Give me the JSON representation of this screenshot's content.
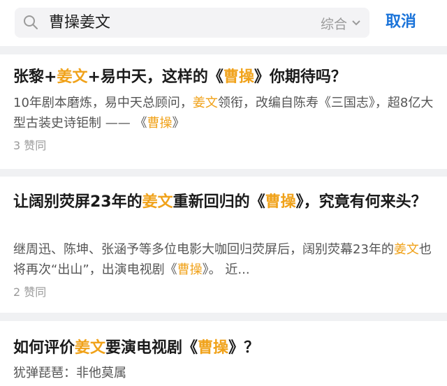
{
  "search": {
    "query": "曹操姜文",
    "filter_label": "综合",
    "cancel_label": "取消"
  },
  "results": [
    {
      "title": [
        {
          "t": "张黎+"
        },
        {
          "t": "姜文",
          "hl": true
        },
        {
          "t": "+易中天，这样的《"
        },
        {
          "t": "曹操",
          "hl": true
        },
        {
          "t": "》你期待吗？"
        }
      ],
      "excerpt": [
        {
          "t": "10年剧本磨炼，易中天总顾问，"
        },
        {
          "t": "姜文",
          "hl": true
        },
        {
          "t": "领衔，改编自陈寿《三国志》，超8亿大型古装史诗钜制 —— 《"
        },
        {
          "t": "曹操",
          "hl": true
        },
        {
          "t": "》"
        }
      ],
      "votes": "3 赞同"
    },
    {
      "title": [
        {
          "t": "让阔别荧屏23年的"
        },
        {
          "t": "姜文",
          "hl": true
        },
        {
          "t": "重新回归的《"
        },
        {
          "t": "曹操",
          "hl": true
        },
        {
          "t": "》，究竟有何来头？"
        }
      ],
      "excerpt": [
        {
          "t": "继周迅、陈坤、张涵予等多位电影大咖回归荧屏后，阔别荧幕23年的"
        },
        {
          "t": "姜文",
          "hl": true
        },
        {
          "t": "也将再次“出山”，出演电视剧《"
        },
        {
          "t": "曹操",
          "hl": true
        },
        {
          "t": "》。 近..."
        }
      ],
      "votes": "2 赞同"
    },
    {
      "title": [
        {
          "t": "如何评价"
        },
        {
          "t": "姜文",
          "hl": true
        },
        {
          "t": "要演电视剧《"
        },
        {
          "t": "曹操",
          "hl": true
        },
        {
          "t": "》？"
        }
      ],
      "excerpt": [
        {
          "t": "犹弹琵琶：非他莫属"
        }
      ],
      "votes": ""
    }
  ],
  "colors": {
    "accent": "#1a73d9",
    "highlight": "#f0a21a"
  }
}
